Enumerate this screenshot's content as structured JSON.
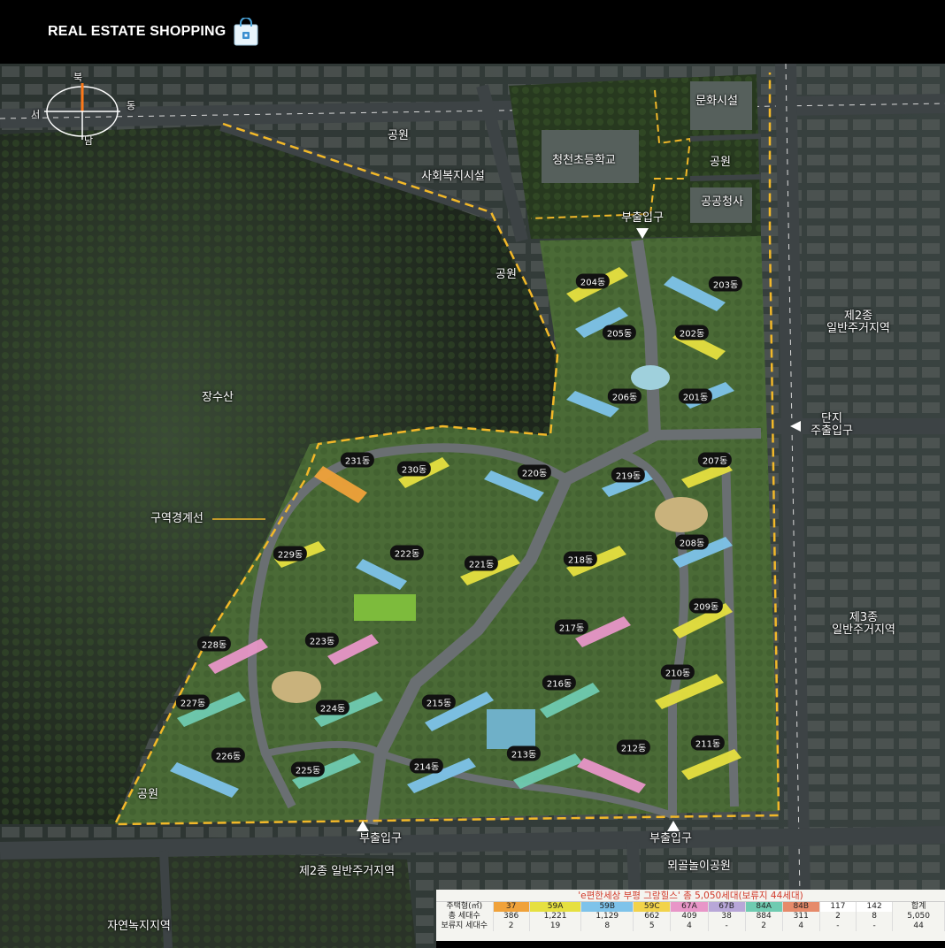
{
  "header": {
    "brand": "REAL ESTATE SHOPPING",
    "bag_icon": "shopping-bag-icon"
  },
  "compass": {
    "north": "북",
    "south": "남",
    "east": "동",
    "west": "서"
  },
  "labels": {
    "park_top": "공원",
    "welfare": "사회복지시설",
    "school": "청천초등학교",
    "culture": "문화시설",
    "park_right": "공원",
    "public_office": "공공청사",
    "park_mid": "공원",
    "mountain": "장수산",
    "boundary": "구역경계선",
    "zone2_right_1": "제2종",
    "zone2_right_2": "일반주거지역",
    "zone3_1": "제3종",
    "zone3_2": "일반주거지역",
    "park_bottom_left": "공원",
    "zone2_bottom": "제2종 일반주거지역",
    "playground_park": "뫼골놀이공원",
    "nature_green": "자연녹지지역",
    "sub_entrance_top": "부출입구",
    "main_entrance_1": "단지",
    "main_entrance_2": "주출입구",
    "sub_entrance_bl": "부출입구",
    "sub_entrance_br": "부출입구"
  },
  "buildings": [
    "204동",
    "203동",
    "205동",
    "202동",
    "206동",
    "201동",
    "231동",
    "230동",
    "220동",
    "219동",
    "207동",
    "229동",
    "222동",
    "221동",
    "218동",
    "208동",
    "228동",
    "223동",
    "217동",
    "209동",
    "227동",
    "224동",
    "215동",
    "216동",
    "210동",
    "226동",
    "225동",
    "214동",
    "213동",
    "212동",
    "211동"
  ],
  "table": {
    "title": "'e편한세상 부평 그랑힐스' 총 5,050세대(보류지 44세대)",
    "header_label": "주택형(㎡)",
    "types": [
      "37",
      "59A",
      "59B",
      "59C",
      "67A",
      "67B",
      "84A",
      "84B",
      "117",
      "142",
      "합계"
    ],
    "type_colors": [
      "#f0a23a",
      "#e6e040",
      "#7ec3ea",
      "#f2d34a",
      "#e896c8",
      "#b8a7d8",
      "#6fcbb1",
      "#e68a6a",
      "#ffffff",
      "#ffffff",
      "#f4f4f0"
    ],
    "rows": [
      {
        "label": "총 세대수",
        "values": [
          "386",
          "1,221",
          "1,129",
          "662",
          "409",
          "38",
          "884",
          "311",
          "2",
          "8",
          "5,050"
        ]
      },
      {
        "label": "보류지 세대수",
        "values": [
          "2",
          "19",
          "8",
          "5",
          "4",
          "-",
          "2",
          "4",
          "-",
          "-",
          "44"
        ]
      }
    ]
  }
}
